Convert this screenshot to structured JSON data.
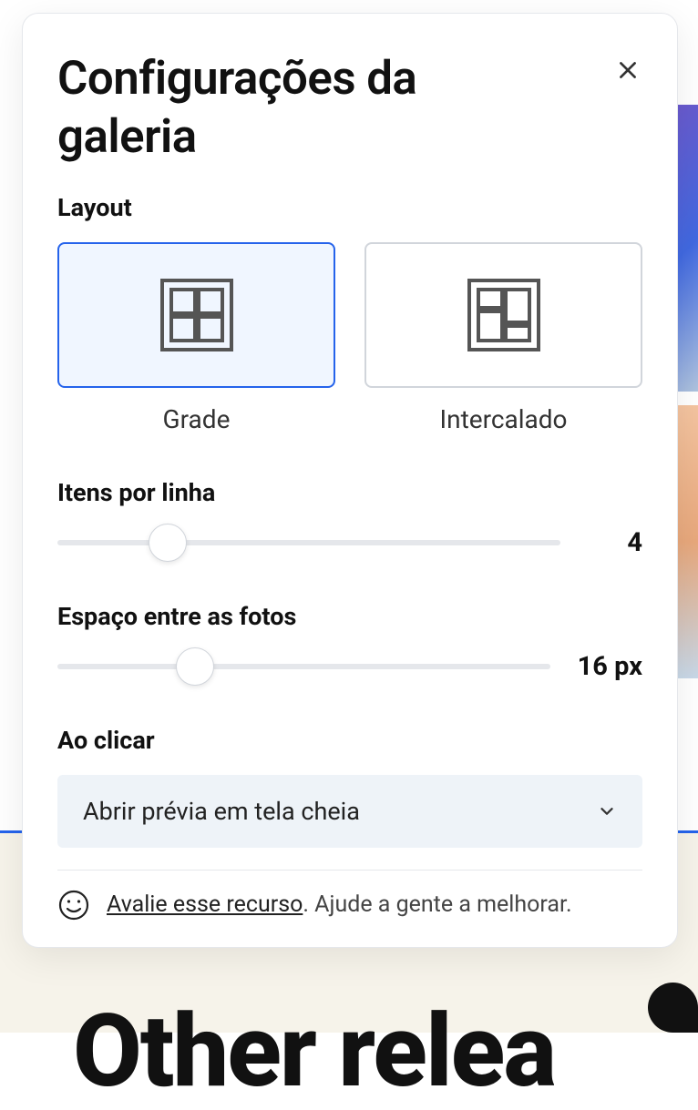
{
  "panel": {
    "title": "Configurações da galeria"
  },
  "layout": {
    "label": "Layout",
    "options": [
      {
        "name": "Grade",
        "selected": true
      },
      {
        "name": "Intercalado",
        "selected": false
      }
    ]
  },
  "items_per_row": {
    "label": "Itens por linha",
    "value": "4",
    "slider_position_pct": 22
  },
  "spacing": {
    "label": "Espaço entre as fotos",
    "value": "16 px",
    "slider_position_pct": 28
  },
  "on_click": {
    "label": "Ao clicar",
    "selected": "Abrir prévia em tela cheia"
  },
  "feedback": {
    "link_text": "Avalie esse recurso",
    "suffix": ". Ajude a gente a melhorar."
  },
  "backdrop": {
    "big_text": "Other relea"
  }
}
